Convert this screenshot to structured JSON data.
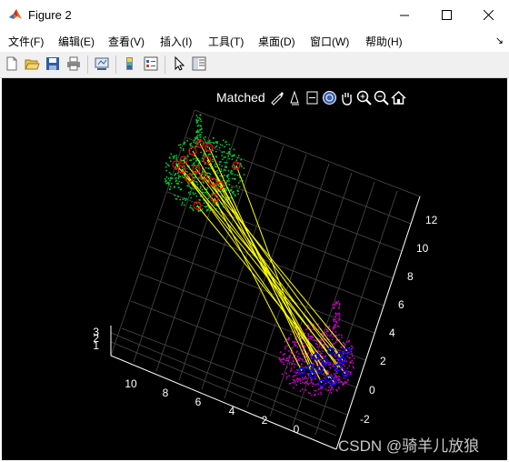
{
  "window": {
    "title": "Figure 2"
  },
  "menus": [
    "文件(F)",
    "编辑(E)",
    "查看(V)",
    "插入(I)",
    "工具(T)",
    "桌面(D)",
    "窗口(W)",
    "帮助(H)"
  ],
  "axes_toolbar": {
    "title": "Matched",
    "icons": [
      "brush-icon",
      "data-tips-icon",
      "pan-axes-icon",
      "rotate-icon",
      "pan-hand-icon",
      "zoom-in-icon",
      "zoom-out-icon",
      "home-icon"
    ]
  },
  "axis": {
    "x_ticks": [
      "10",
      "8",
      "6",
      "4",
      "2",
      "0"
    ],
    "y_ticks": [
      "12",
      "10",
      "8",
      "6",
      "4",
      "2",
      "0",
      "-2"
    ],
    "z_ticks": [
      "3",
      "2",
      "1"
    ]
  },
  "colors": {
    "background": "#000000",
    "source_points": "#00cc33",
    "target_points": "#cc00cc",
    "match_lines": "#ffff00",
    "source_keypoints": "#ff0000",
    "target_keypoints": "#0000ff",
    "grid": "#4a4a4a"
  },
  "watermark": "CSDN @骑羊儿放狼"
}
